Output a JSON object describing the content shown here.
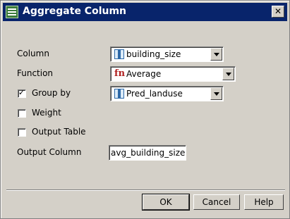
{
  "window": {
    "title": "Aggregate Column",
    "close_glyph": "✕"
  },
  "form": {
    "column": {
      "label": "Column",
      "value": "building_size",
      "icon": "column-icon"
    },
    "function": {
      "label": "Function",
      "value": "Average",
      "icon": "fn-icon",
      "icon_text": "fn"
    },
    "group_by": {
      "label": "Group by",
      "checked": true,
      "value": "Pred_landuse",
      "icon": "column-icon"
    },
    "weight": {
      "label": "Weight",
      "checked": false
    },
    "output_table": {
      "label": "Output Table",
      "checked": false
    },
    "output_column": {
      "label": "Output Column",
      "value": "avg_building_size"
    }
  },
  "buttons": {
    "ok": "OK",
    "cancel": "Cancel",
    "help": "Help"
  },
  "colors": {
    "titlebar": "#08246b",
    "dialog_bg": "#d4d0c8"
  }
}
